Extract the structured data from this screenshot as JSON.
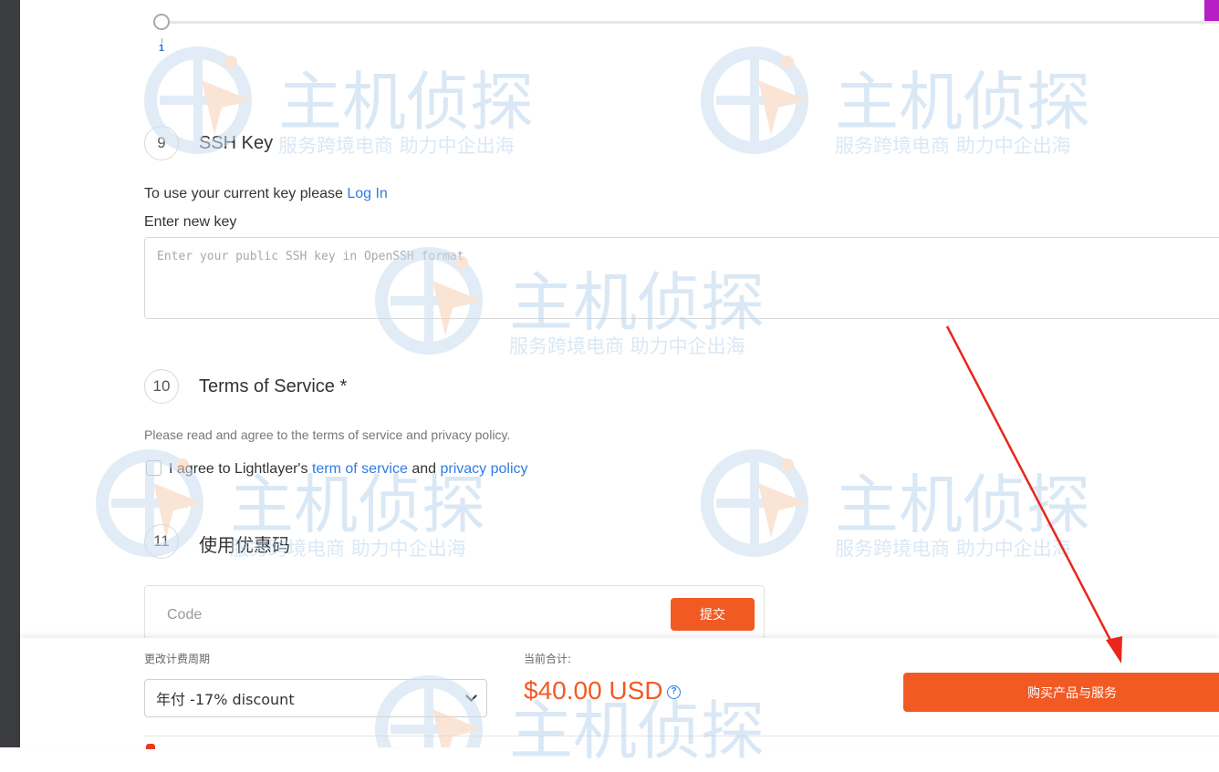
{
  "slider": {
    "value": "1"
  },
  "ssh_section": {
    "step": "9",
    "title": "SSH Key",
    "login_prompt": "To use your current key please",
    "login_link": "Log In",
    "new_key_label": "Enter new key",
    "key_placeholder": "Enter your public SSH key in OpenSSH format"
  },
  "tos_section": {
    "step": "10",
    "title": "Terms of Service *",
    "description": "Please read and agree to the terms of service and privacy policy.",
    "agree_prefix": "I agree to Lightlayer's",
    "tos_link": "term of service",
    "and_word": "and",
    "privacy_link": "privacy policy"
  },
  "coupon_section": {
    "step": "11",
    "title": "使用优惠码",
    "code_placeholder": "Code",
    "submit_label": "提交"
  },
  "bottom_bar": {
    "period_label": "更改计费周期",
    "period_value": "年付 -17% discount",
    "total_label": "当前合计:",
    "total_price": "$40.00 USD",
    "help_glyph": "?",
    "buy_label": "购买产品与服务"
  },
  "watermark": {
    "brand": "主机侦探",
    "slogan": "服务跨境电商 助力中企出海"
  },
  "colors": {
    "accent": "#f25a24",
    "link": "#2f7de1",
    "annotation_arrow": "#e8261c"
  }
}
